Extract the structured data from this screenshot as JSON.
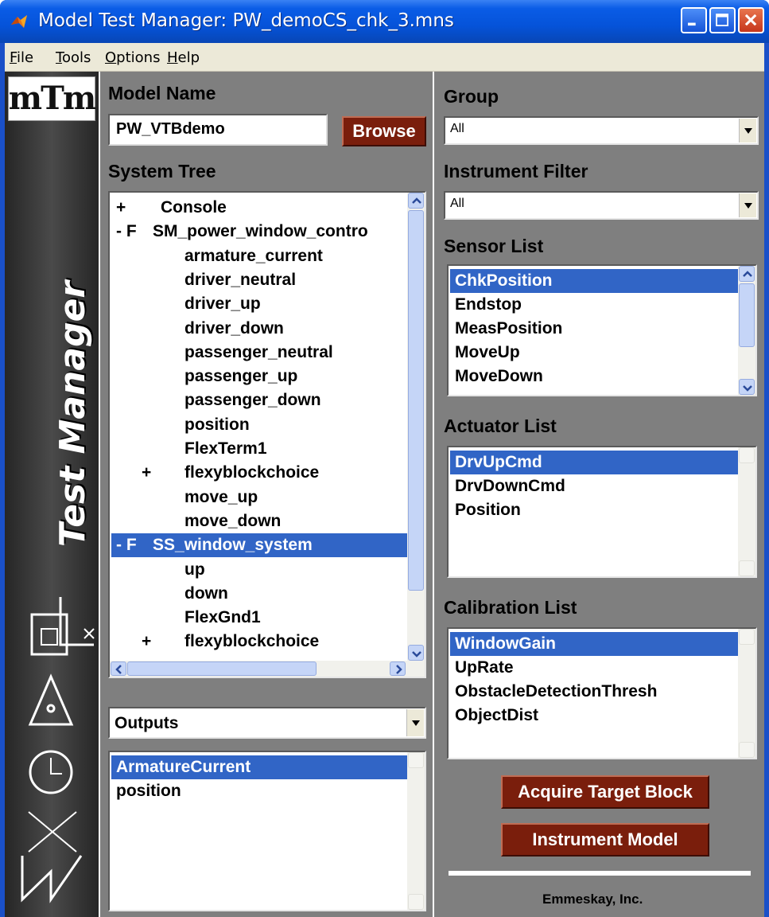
{
  "window": {
    "title": "Model Test Manager: PW_demoCS_chk_3.mns"
  },
  "menu": [
    {
      "label": "File",
      "u": "F",
      "rest": "ile"
    },
    {
      "label": "Tools",
      "u": "T",
      "rest": "ools"
    },
    {
      "label": "Options",
      "u": "O",
      "rest": "ptions"
    },
    {
      "label": "Help",
      "u": "H",
      "rest": "elp"
    }
  ],
  "logo": {
    "text": "mTm",
    "vertical": "Test Manager"
  },
  "model": {
    "label": "Model Name",
    "value": "PW_VTBdemo",
    "browse": "Browse"
  },
  "tree": {
    "label": "System Tree",
    "rows": [
      {
        "prefix": "+",
        "name": "Console"
      },
      {
        "prefix": "- F",
        "name": "SM_power_window_contro"
      },
      {
        "prefix": "",
        "name": "armature_current"
      },
      {
        "prefix": "",
        "name": "driver_neutral"
      },
      {
        "prefix": "",
        "name": "driver_up"
      },
      {
        "prefix": "",
        "name": "driver_down"
      },
      {
        "prefix": "",
        "name": "passenger_neutral"
      },
      {
        "prefix": "",
        "name": "passenger_up"
      },
      {
        "prefix": "",
        "name": "passenger_down"
      },
      {
        "prefix": "",
        "name": "position"
      },
      {
        "prefix": "",
        "name": "FlexTerm1"
      },
      {
        "prefix": "+",
        "name": "flexyblockchoice"
      },
      {
        "prefix": "",
        "name": "move_up"
      },
      {
        "prefix": "",
        "name": "move_down"
      },
      {
        "prefix": "- F",
        "name": "SS_window_system"
      },
      {
        "prefix": "",
        "name": "up"
      },
      {
        "prefix": "",
        "name": "down"
      },
      {
        "prefix": "",
        "name": "FlexGnd1"
      },
      {
        "prefix": "+",
        "name": "flexyblockchoice"
      }
    ]
  },
  "outputs": {
    "selected": "Outputs",
    "items": [
      "ArmatureCurrent",
      "position"
    ]
  },
  "group": {
    "label": "Group",
    "value": "All"
  },
  "instrument_filter": {
    "label": "Instrument Filter",
    "value": "All"
  },
  "sensor": {
    "label": "Sensor List",
    "items": [
      "ChkPosition",
      "Endstop",
      "MeasPosition",
      "MoveUp",
      "MoveDown"
    ]
  },
  "actuator": {
    "label": "Actuator List",
    "items": [
      "DrvUpCmd",
      "DrvDownCmd",
      "Position"
    ]
  },
  "calibration": {
    "label": "Calibration List",
    "items": [
      "WindowGain",
      "UpRate",
      "ObstacleDetectionThresh",
      "ObjectDist"
    ]
  },
  "actions": {
    "acquire": "Acquire Target Block",
    "instrument": "Instrument Model"
  },
  "footer": "Emmeskay, Inc.",
  "colors": {
    "selection": "#3165c6",
    "button": "#7a1e0c",
    "panel": "#7f7f7f",
    "titlebar": "#0553d9"
  }
}
